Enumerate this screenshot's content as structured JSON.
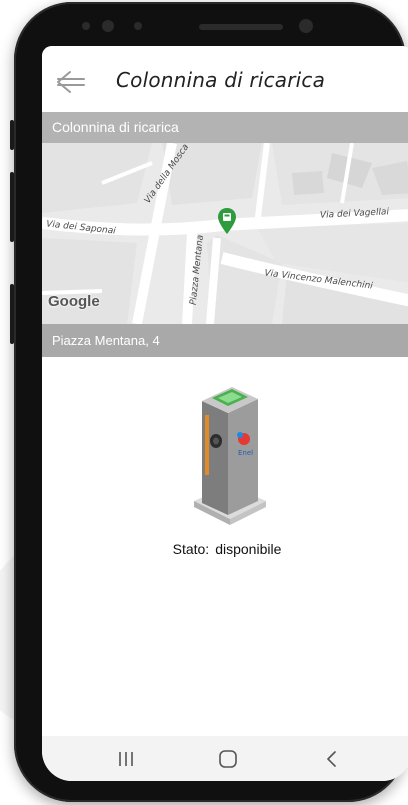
{
  "app": {
    "title": "Colonnina di ricarica",
    "back_icon": "arrow-left-icon"
  },
  "map_section": {
    "header_title": "Colonnina di ricarica",
    "address": "Piazza Mentana, 4",
    "streets": {
      "via_dei_saponai": "Via dei Saponai",
      "via_della_mosca": "Via della Mosca",
      "via_dei_vagellai": "Via dei Vagellai",
      "piazza_mentana": "Piazza Mentana",
      "via_vincenzo_malenchini": "Via Vincenzo Malenchini"
    },
    "map_logo": "Google",
    "pin_color": "#2e9b3e",
    "pin_icon": "ev-charger-pin-icon"
  },
  "station": {
    "status_label": "Stato:",
    "status_value": "disponibile",
    "icon": "charging-station-icon"
  },
  "system_nav": {
    "recents_icon": "recents-icon",
    "home_icon": "home-icon",
    "back_icon": "back-chevron-icon"
  },
  "colors": {
    "header_bar": "#b3b3b3",
    "address_bar": "#a9a9a9",
    "phone_frame": "#101010"
  }
}
